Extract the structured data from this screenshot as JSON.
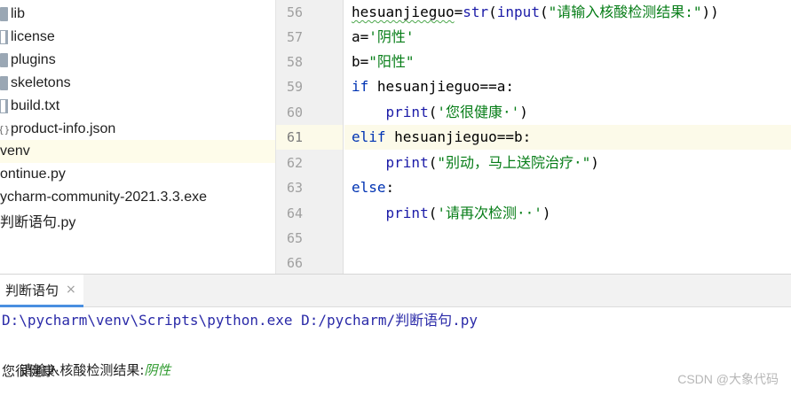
{
  "project_tree": {
    "items": [
      {
        "label": "lib",
        "icon": "folder-icon"
      },
      {
        "label": "license",
        "icon": "file-icon"
      },
      {
        "label": "plugins",
        "icon": "folder-icon"
      },
      {
        "label": "skeletons",
        "icon": "folder-icon"
      },
      {
        "label": "build.txt",
        "icon": "text-file-icon"
      },
      {
        "label": "product-info.json",
        "icon": "json-file-icon"
      },
      {
        "label": "venv",
        "icon": ""
      },
      {
        "label": "ontinue.py",
        "icon": ""
      },
      {
        "label": "ycharm-community-2021.3.3.exe",
        "icon": ""
      },
      {
        "label": "判断语句.py",
        "icon": ""
      }
    ]
  },
  "editor": {
    "line_numbers": [
      "56",
      "57",
      "58",
      "59",
      "60",
      "61",
      "62",
      "63",
      "64",
      "65",
      "66"
    ],
    "current_line": "61",
    "lines": {
      "l56": {
        "var": "hesuanjieguo",
        "eq": "=",
        "fn1": "str",
        "p1": "(",
        "fn2": "input",
        "p2": "(",
        "s": "\"请输入核酸检测结果:\"",
        "close": "))"
      },
      "l57": {
        "var": "a",
        "eq": "=",
        "s": "'阴性'"
      },
      "l58": {
        "var": "b",
        "eq": "=",
        "s": "\"阳性\""
      },
      "l59": {
        "kw": "if",
        "cond": " hesuanjieguo==a:"
      },
      "l60": {
        "indent": "    ",
        "fn": "print",
        "p": "(",
        "s": "'您很健康·'",
        "close": ")"
      },
      "l61": {
        "kw": "elif",
        "cond": " hesuanjieguo==b:"
      },
      "l62": {
        "indent": "    ",
        "fn": "print",
        "p": "(",
        "s": "\"别动，马上送院治疗·\"",
        "close": ")"
      },
      "l63": {
        "kw": "else",
        "cond": ":"
      },
      "l64": {
        "indent": "    ",
        "fn": "print",
        "p": "(",
        "s": "'请再次检测··'",
        "close": ")"
      }
    }
  },
  "run_panel": {
    "tab_label": "判断语句",
    "tab_close": "×",
    "command": "D:\\pycharm\\venv\\Scripts\\python.exe D:/pycharm/判断语句.py",
    "prompt": "请输入核酸检测结果:",
    "user_input": "阴性",
    "output": "您很健康·"
  },
  "watermark": "CSDN @大象代码",
  "colors": {
    "keyword": "#0033b3",
    "builtin": "#1c1ca8",
    "string": "#067d17",
    "current_line_bg": "#fcfae9",
    "gutter_bg": "#f0f0f0",
    "tab_underline": "#4a8fe0",
    "console_cmd": "#2a2aa8",
    "console_input": "#2f9b2f"
  }
}
